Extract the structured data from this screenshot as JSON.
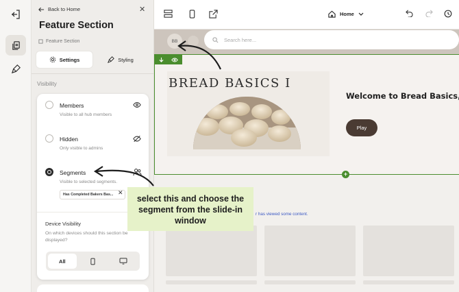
{
  "rail": {
    "icons": [
      "exit-icon",
      "pages-icon",
      "brush-icon"
    ]
  },
  "panel": {
    "back_label": "Back to Home",
    "title": "Feature Section",
    "subtitle": "Feature Section",
    "tabs": [
      {
        "label": "Settings",
        "icon": "gear-icon",
        "active": true
      },
      {
        "label": "Styling",
        "icon": "brush-icon",
        "active": false
      }
    ],
    "visibility_label": "Visibility",
    "options": [
      {
        "title": "Members",
        "desc": "Visible to all hub members",
        "icon": "eye-icon",
        "selected": false
      },
      {
        "title": "Hidden",
        "desc": "Only visible to admins",
        "icon": "eye-off-icon",
        "selected": false
      },
      {
        "title": "Segments",
        "desc": "Visible to selected segments.",
        "icon": "users-icon",
        "selected": true
      }
    ],
    "segment_chip": "Has Completed Bakers Bas...",
    "device": {
      "title": "Device Visibility",
      "desc": "On which devices should this section be displayed?",
      "options": [
        {
          "label": "All",
          "active": true
        },
        {
          "label": "",
          "icon": "phone-icon"
        },
        {
          "label": "",
          "icon": "desktop-icon"
        }
      ]
    }
  },
  "toolbar": {
    "page_select": "Home"
  },
  "site": {
    "avatar": "BB",
    "search_placeholder": "Search here...",
    "hero_title": "BREAD BASICS I",
    "welcome": "Welcome to Bread Basics,",
    "play_label": "Play",
    "viewed_text": "r has viewed some content."
  },
  "callout": {
    "text": "select this and choose the segment from the slide-in window"
  },
  "colors": {
    "accent_green": "#4a8d2e",
    "button_brown": "#4a3b33",
    "callout_bg": "#e6f2c9",
    "link_blue": "#3d5ac4"
  }
}
